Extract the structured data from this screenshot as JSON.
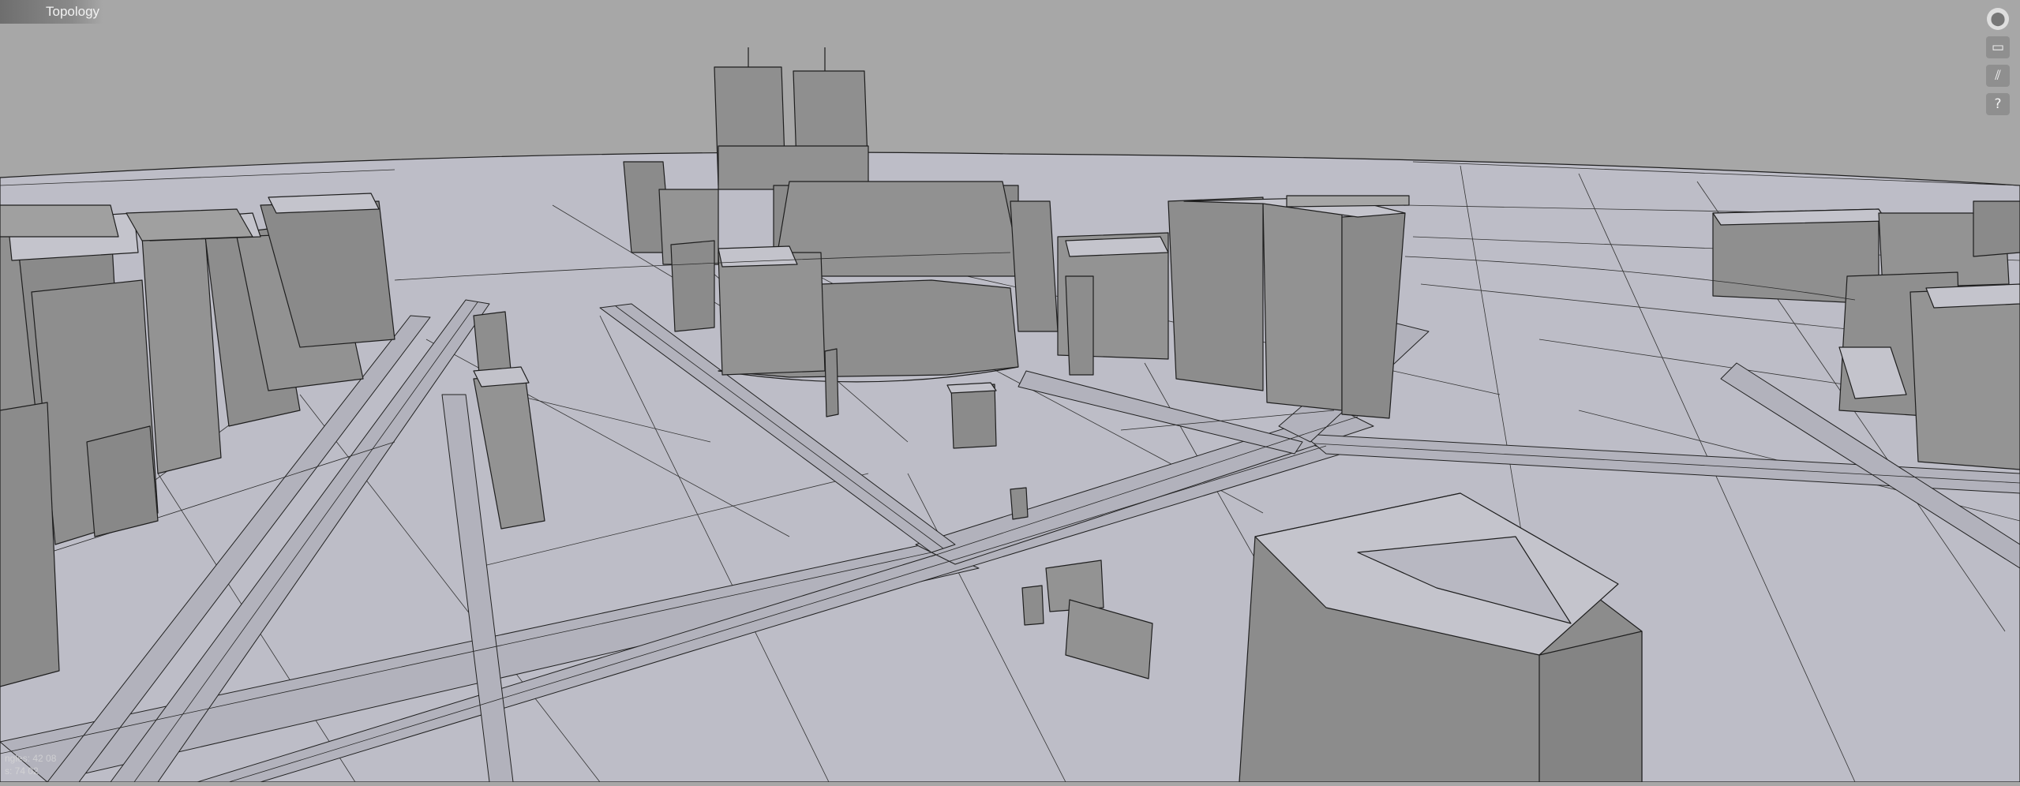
{
  "view": {
    "mode_label": "Topology"
  },
  "toolbar": {
    "buttons": [
      {
        "icon": "view-cube-icon",
        "glyph": "⬤"
      },
      {
        "icon": "panel-icon",
        "glyph": "▭"
      },
      {
        "icon": "wireframe-icon",
        "glyph": "⫽"
      },
      {
        "icon": "help-icon",
        "glyph": "?"
      }
    ]
  },
  "stats": {
    "triangles": "ngles: 42 08",
    "vertices": "s: 74 02"
  },
  "colors": {
    "sky": "#a7a7a7",
    "ground": "#bcbcc6",
    "building": "#8c8c8c",
    "edge": "#202020"
  }
}
